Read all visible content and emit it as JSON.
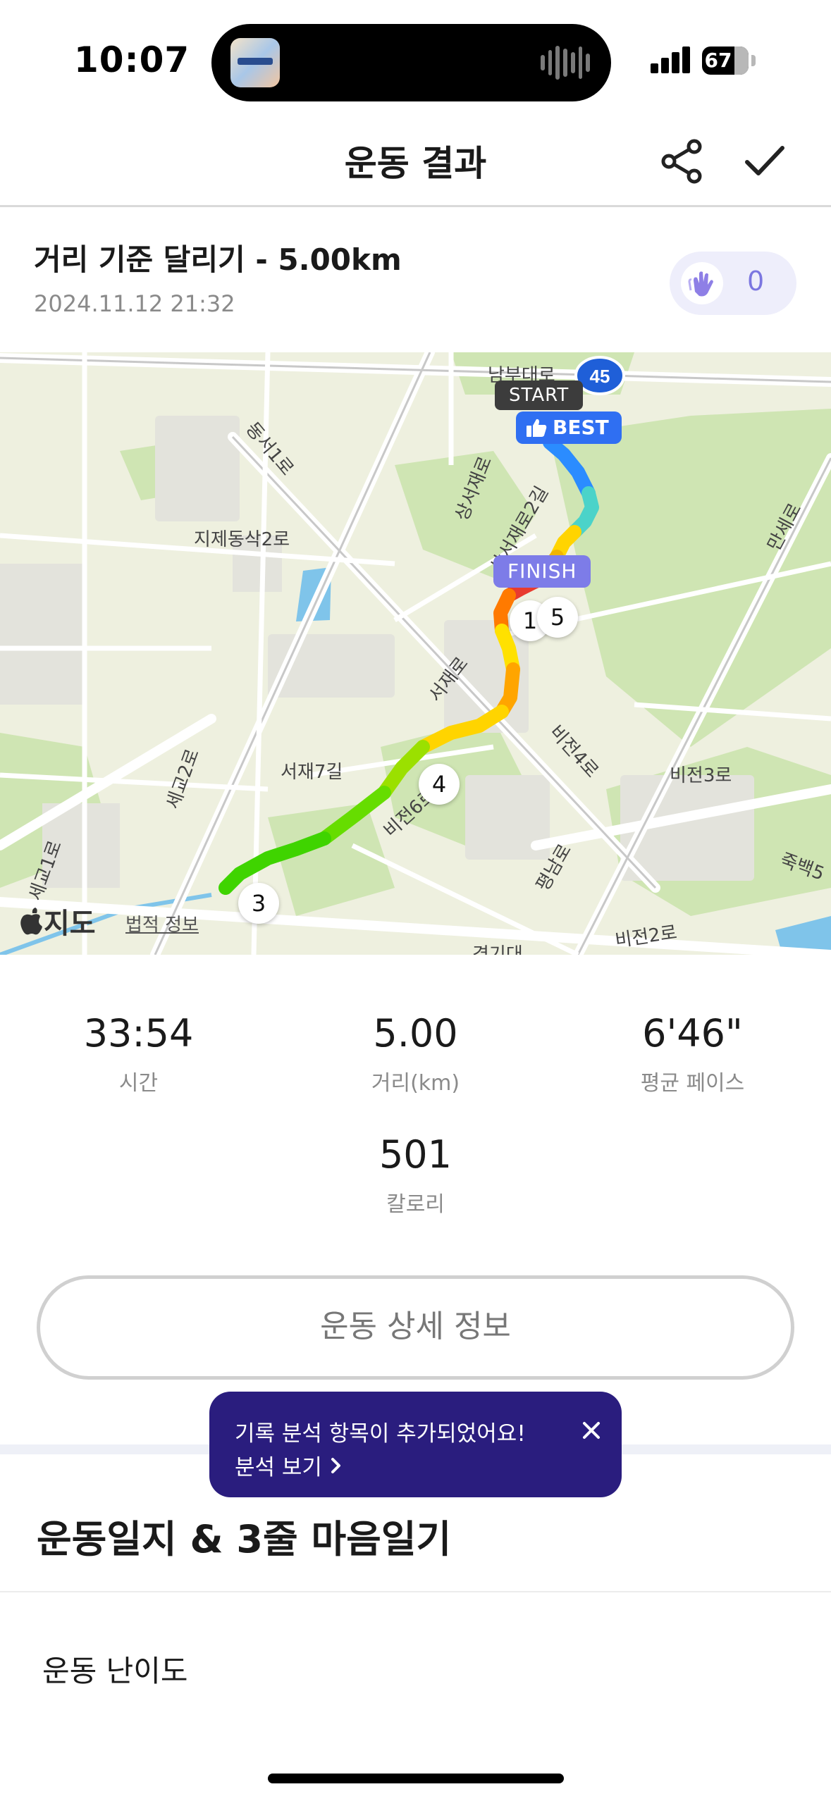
{
  "status_bar": {
    "time": "10:07",
    "battery": "67"
  },
  "nav": {
    "title": "운동 결과",
    "share_icon": "share-icon",
    "confirm_icon": "checkmark-icon"
  },
  "workout": {
    "title": "거리 기준 달리기 - 5.00km",
    "date": "2024.11.12 21:32",
    "clap_count": "0"
  },
  "map": {
    "start_label": "START",
    "best_label": "BEST",
    "finish_label": "FINISH",
    "km_markers": [
      "1",
      "5",
      "4",
      "3"
    ],
    "road_labels": [
      "남부대로",
      "동서1로",
      "지제동삭2로",
      "상서재로",
      "상서재로2길",
      "만세로",
      "서재로",
      "비전4로",
      "비전3로",
      "서재7길",
      "세교2로",
      "비전6로",
      "평남로",
      "죽백5",
      "세교1로",
      "비전2로",
      "경기대"
    ],
    "highway_shield": "45",
    "logo": "지도",
    "legal": "법적 정보"
  },
  "stats": [
    {
      "value": "33:54",
      "label": "시간"
    },
    {
      "value": "5.00",
      "label": "거리(km)"
    },
    {
      "value": "6'46\"",
      "label": "평균 페이스"
    },
    {
      "value": "501",
      "label": "칼로리"
    }
  ],
  "detail_button": "운동 상세 정보",
  "tooltip": {
    "message": "기록 분석 항목이 추가되었어요!",
    "link": "분석 보기"
  },
  "journal": {
    "title": "운동일지 & 3줄 마음일기",
    "difficulty_label": "운동 난이도"
  },
  "colors": {
    "accent_purple": "#7d7ce8",
    "tooltip_bg": "#2a1d7e",
    "best_blue": "#2f6ff2"
  }
}
